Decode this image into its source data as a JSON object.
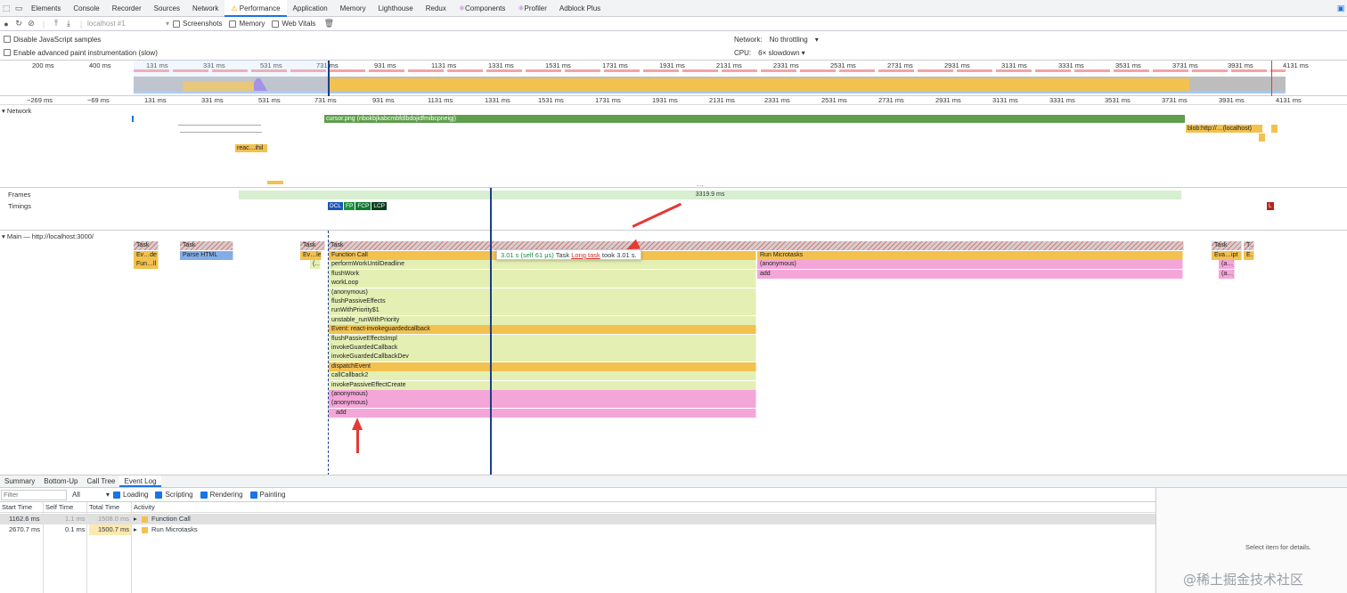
{
  "tabs": [
    "Elements",
    "Console",
    "Recorder",
    "Sources",
    "Network",
    "Performance",
    "Application",
    "Memory",
    "Lighthouse",
    "Redux",
    "Components",
    "Profiler",
    "Adblock Plus"
  ],
  "active_tab": "Performance",
  "toolbar": {
    "profile_select": "localhost #1",
    "screenshots_label": "Screenshots",
    "memory_label": "Memory",
    "webvitals_label": "Web Vitals"
  },
  "settings": {
    "disable_js_samples": "Disable JavaScript samples",
    "advanced_paint": "Enable advanced paint instrumentation (slow)",
    "network_label": "Network:",
    "network_value": "No throttling",
    "cpu_label": "CPU:",
    "cpu_value": "6× slowdown"
  },
  "overview_ticks": [
    "200 ms",
    "400 ms",
    "131 ms",
    "331 ms",
    "531 ms",
    "731 ms",
    "931 ms",
    "1131 ms",
    "1331 ms",
    "1531 ms",
    "1731 ms",
    "1931 ms",
    "2131 ms",
    "2331 ms",
    "2531 ms",
    "2731 ms",
    "2931 ms",
    "3131 ms",
    "3331 ms",
    "3531 ms",
    "3731 ms",
    "3931 ms",
    "4131 ms"
  ],
  "ruler_ticks": [
    "−269 ms",
    "−69 ms",
    "131 ms",
    "331 ms",
    "531 ms",
    "731 ms",
    "931 ms",
    "1131 ms",
    "1331 ms",
    "1531 ms",
    "1731 ms",
    "1931 ms",
    "2131 ms",
    "2331 ms",
    "2531 ms",
    "2731 ms",
    "2931 ms",
    "3131 ms",
    "3331 ms",
    "3531 ms",
    "3731 ms",
    "3931 ms",
    "4131 ms"
  ],
  "network": {
    "track_name": "Network",
    "cursor_request": "cursor.png (nbokbjkabcmbfdlbdojidfmibcpneigj)",
    "react_request": "reac…ihil",
    "blob_request": "blob:http://…(localhost)"
  },
  "frames": {
    "label": "Frames",
    "duration": "3319.9 ms"
  },
  "timings": {
    "label": "Timings",
    "markers": [
      "DCL",
      "FP",
      "FCP",
      "LCP"
    ],
    "l_marker": "L"
  },
  "main": {
    "track_name": "Main — http://localhost:3000/",
    "task_label": "Task",
    "left_tasks": [
      "Task",
      "Task",
      "Task"
    ],
    "left_sub": [
      "Ev…de",
      "Parse HTML",
      "Ev…le"
    ],
    "left_sub2": [
      "Fun…ll",
      "(…"
    ],
    "stack": [
      "Function Call",
      "performWorkUntilDeadline",
      "flushWork",
      "workLoop",
      "(anonymous)",
      "flushPassiveEffects",
      "runWithPriority$1",
      "unstable_runWithPriority",
      "Event: react-invokeguardedcallback",
      "flushPassiveEffectsImpl",
      "invokeGuardedCallback",
      "invokeGuardedCallbackDev",
      "dispatchEvent",
      "callCallback2",
      "invokePassiveEffectCreate",
      "(anonymous)",
      "(anonymous)",
      "add"
    ],
    "microtasks": [
      "Run Microtasks",
      "(anonymous)",
      "add"
    ],
    "right_labels": [
      "Task",
      "T…",
      "Eva…ipt",
      "E…",
      "(a…)",
      "(a…)"
    ],
    "tooltip": {
      "time": "3.01 s (self 61 μs)",
      "task": "Task",
      "link": "Long task",
      "rest": "took 3.01 s."
    }
  },
  "bottom": {
    "tabs": [
      "Summary",
      "Bottom-Up",
      "Call Tree",
      "Event Log"
    ],
    "active_tab": "Event Log",
    "filter_placeholder": "Filter",
    "all_select": "All",
    "checks": [
      "Loading",
      "Scripting",
      "Rendering",
      "Painting"
    ],
    "columns": [
      "Start Time",
      "Self Time",
      "Total Time",
      "Activity"
    ],
    "rows": [
      {
        "start": "1162.6 ms",
        "self": "1.1 ms",
        "total": "1508.0 ms",
        "activity": "Function Call"
      },
      {
        "start": "2670.7 ms",
        "self": "0.1 ms",
        "total": "1500.7 ms",
        "activity": "Run Microtasks"
      }
    ],
    "details_text": "Select item for details."
  },
  "watermark": "@稀土掘金技术社区",
  "colors": {
    "scripting": "#f2c14e",
    "js_frames": "#e4efb4",
    "pink": "#f4a6d9",
    "accent": "#1a73e8",
    "arrow": "#e53935"
  }
}
